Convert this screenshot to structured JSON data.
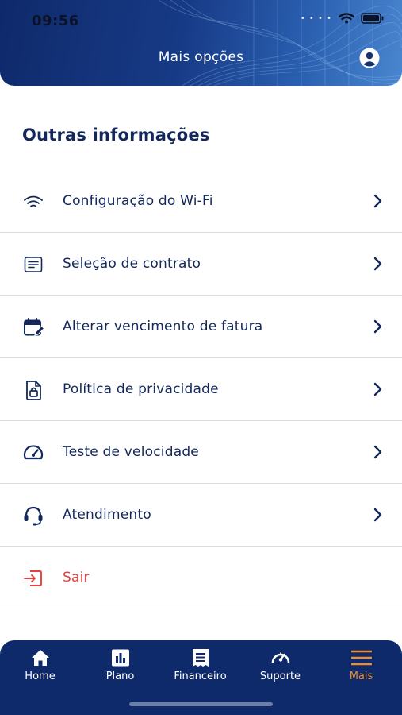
{
  "status_bar": {
    "time": "09:56"
  },
  "header": {
    "title": "Mais opções"
  },
  "section": {
    "title": "Outras informações"
  },
  "menu": {
    "items": [
      {
        "label": "Configuração do Wi-Fi",
        "icon": "wifi-icon"
      },
      {
        "label": "Seleção de contrato",
        "icon": "document-icon"
      },
      {
        "label": "Alterar vencimento de fatura",
        "icon": "calendar-edit-icon"
      },
      {
        "label": "Política de privacidade",
        "icon": "lock-file-icon"
      },
      {
        "label": "Teste de velocidade",
        "icon": "speedometer-icon"
      },
      {
        "label": "Atendimento",
        "icon": "headset-icon"
      },
      {
        "label": "Sair",
        "icon": "logout-icon"
      }
    ]
  },
  "bottom_nav": {
    "items": [
      {
        "label": "Home",
        "icon": "home-icon"
      },
      {
        "label": "Plano",
        "icon": "chart-icon"
      },
      {
        "label": "Financeiro",
        "icon": "receipt-icon"
      },
      {
        "label": "Suporte",
        "icon": "support-icon"
      },
      {
        "label": "Mais",
        "icon": "menu-icon"
      }
    ],
    "active": "Mais"
  },
  "colors": {
    "primary": "#13275a",
    "header_bg": "#0f2a6b",
    "accent_active": "#f08a2c",
    "danger": "#e4403c",
    "divider": "#d7dbe2"
  }
}
